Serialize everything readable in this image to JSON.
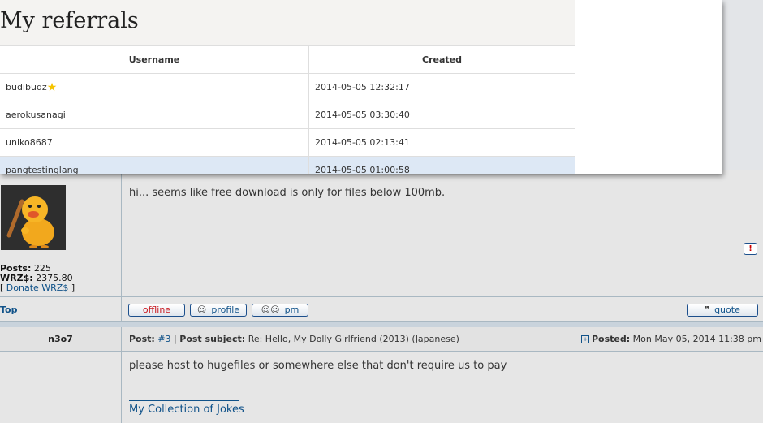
{
  "referrals": {
    "title": "My referrals",
    "columns": {
      "username": "Username",
      "created": "Created"
    },
    "rows": [
      {
        "username": "budibudz",
        "created": "2014-05-05 12:32:17"
      },
      {
        "username": "aerokusanagi",
        "created": "2014-05-05 03:30:40"
      },
      {
        "username": "uniko8687",
        "created": "2014-05-05 02:13:41"
      },
      {
        "username": "pangtestinglang",
        "created": "2014-05-05 01:00:58"
      }
    ]
  },
  "post1": {
    "stats": {
      "posts_label": "Posts:",
      "posts_value": "225",
      "wrz_label": "WRZ$:",
      "wrz_value": "2375.80",
      "donate_open": "[",
      "donate_label": "Donate WRZ$",
      "donate_close": "]"
    },
    "body": "hi... seems like free download is only for files below 100mb.",
    "report_icon": "!",
    "footer": {
      "top_label": "Top",
      "offline_label": "offline",
      "profile_label": "profile",
      "pm_label": "pm",
      "quote_label": "quote"
    }
  },
  "post2": {
    "author": "n3o7",
    "post_label": "Post:",
    "post_number": "#3",
    "separator": "|",
    "subject_label": "Post subject:",
    "subject": "Re: Hello, My Dolly Girlfriend (2013) (Japanese)",
    "posted_label": "Posted:",
    "posted_date": "Mon May 05, 2014 11:38 pm",
    "body": "please host to hugefiles or somewhere else that don't require us to pay",
    "signature": "My Collection of Jokes"
  },
  "colors": {
    "link": "#105289",
    "offline": "#c8161d",
    "highlight_row": "#dde8f5"
  }
}
